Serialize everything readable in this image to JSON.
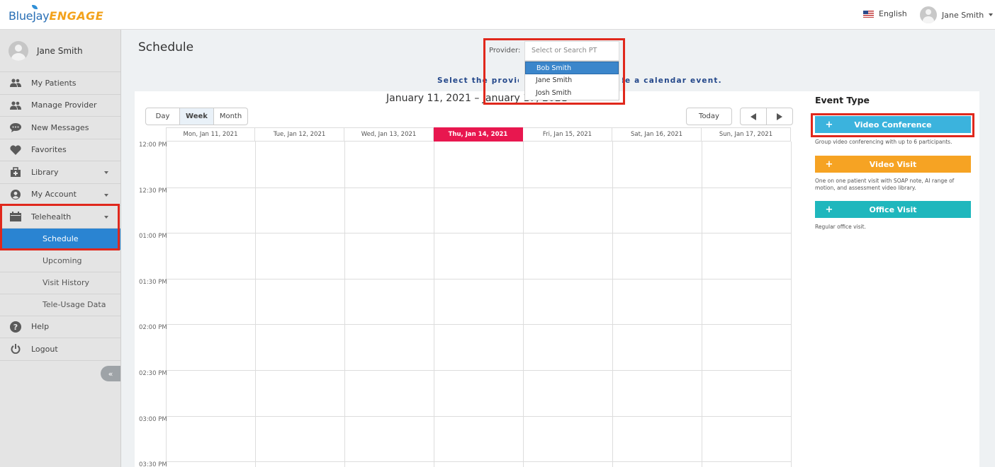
{
  "header": {
    "logo_main": "BlueJay",
    "logo_sub": "ENGAGE",
    "language": "English",
    "user_name": "Jane Smith"
  },
  "sidebar": {
    "user_name": "Jane Smith",
    "items": [
      {
        "label": "My Patients",
        "icon": "patients-icon"
      },
      {
        "label": "Manage Provider",
        "icon": "providers-icon"
      },
      {
        "label": "New Messages",
        "icon": "chat-icon"
      },
      {
        "label": "Favorites",
        "icon": "heart-icon"
      },
      {
        "label": "Library",
        "icon": "library-icon"
      },
      {
        "label": "My Account",
        "icon": "account-icon"
      },
      {
        "label": "Telehealth",
        "icon": "calendar-icon"
      }
    ],
    "telehealth_sub": [
      "Schedule",
      "Upcoming",
      "Visit History",
      "Tele-Usage Data"
    ],
    "help": "Help",
    "logout": "Logout",
    "collapse": "«"
  },
  "main": {
    "title": "Schedule",
    "provider_label": "Provider:",
    "provider_placeholder": "Select or Search PT",
    "provider_options": [
      "Bob Smith",
      "Jane Smith",
      "Josh Smith"
    ],
    "hint": "Select the provider to view and create a calendar event."
  },
  "calendar": {
    "heading": "January 11, 2021 – January 17, 2021",
    "views": [
      "Day",
      "Week",
      "Month"
    ],
    "today_label": "Today",
    "days": [
      "Mon, Jan 11, 2021",
      "Tue, Jan 12, 2021",
      "Wed, Jan 13, 2021",
      "Thu, Jan 14, 2021",
      "Fri, Jan 15, 2021",
      "Sat, Jan 16, 2021",
      "Sun, Jan 17, 2021"
    ],
    "today_index": 3,
    "times": [
      "12:00 PM",
      "12:30 PM",
      "01:00 PM",
      "01:30 PM",
      "02:00 PM",
      "02:30 PM",
      "03:00 PM",
      "03:30 PM"
    ]
  },
  "event_type": {
    "title": "Event Type",
    "items": [
      {
        "label": "Video Conference",
        "desc": "Group video conferencing with up to 6 participants.",
        "color": "#3bb3dd"
      },
      {
        "label": "Video Visit",
        "desc": "One on one patient visit with SOAP note, AI range of motion, and assessment video library.",
        "color": "#f6a323"
      },
      {
        "label": "Office Visit",
        "desc": "Regular office visit.",
        "color": "#1fb7bd"
      }
    ]
  },
  "colors": {
    "highlight": "#e0281c",
    "active_nav": "#2a84d2",
    "today": "#e8174f"
  }
}
